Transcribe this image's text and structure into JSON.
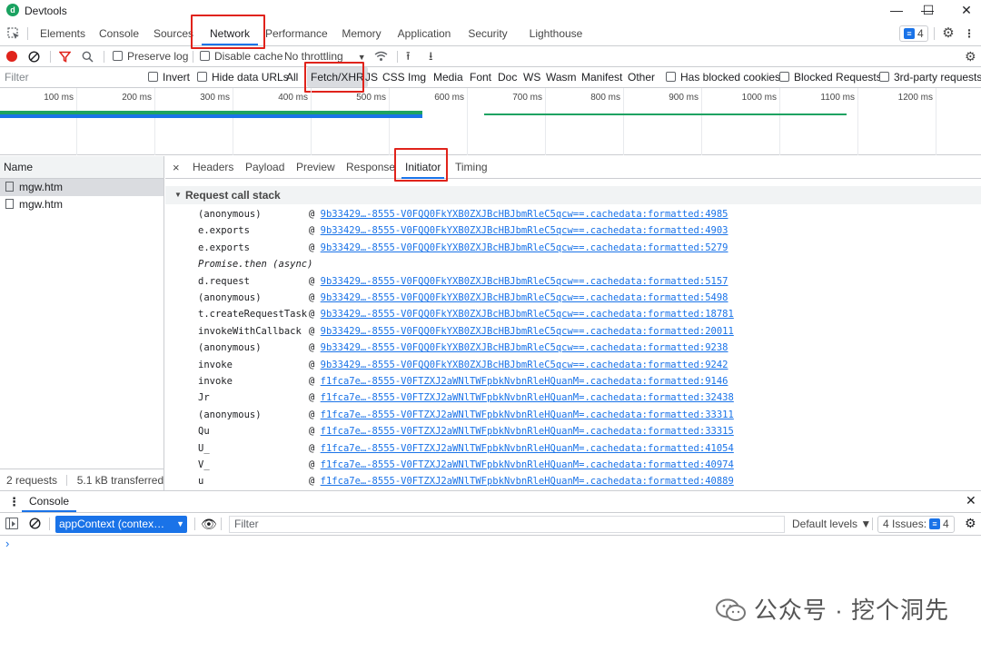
{
  "window": {
    "title": "Devtools",
    "minimize": "—",
    "maximize": "☐",
    "close": "✕"
  },
  "panel_tabs": [
    "Elements",
    "Console",
    "Sources",
    "Network",
    "Performance",
    "Memory",
    "Application",
    "Security",
    "Lighthouse"
  ],
  "active_panel": "Network",
  "issues_count": "4",
  "toolbar": {
    "preserve_log": "Preserve log",
    "disable_cache": "Disable cache",
    "throttling": "No throttling"
  },
  "filterbar": {
    "placeholder": "Filter",
    "invert": "Invert",
    "hide_data_urls": "Hide data URLs",
    "types": [
      "All",
      "Fetch/XHR",
      "JS",
      "CSS",
      "Img",
      "Media",
      "Font",
      "Doc",
      "WS",
      "Wasm",
      "Manifest",
      "Other"
    ],
    "has_blocked_cookies": "Has blocked cookies",
    "blocked_requests": "Blocked Requests",
    "third_party": "3rd-party requests"
  },
  "timeline": {
    "ticks": [
      "100 ms",
      "200 ms",
      "300 ms",
      "400 ms",
      "500 ms",
      "600 ms",
      "700 ms",
      "800 ms",
      "900 ms",
      "1000 ms",
      "1100 ms",
      "1200 ms"
    ]
  },
  "requests": {
    "header": "Name",
    "rows": [
      "mgw.htm",
      "mgw.htm"
    ],
    "summary_requests": "2 requests",
    "summary_transferred": "5.1 kB transferred"
  },
  "detail_tabs": [
    "Headers",
    "Payload",
    "Preview",
    "Response",
    "Initiator",
    "Timing"
  ],
  "active_detail_tab": "Initiator",
  "call_stack": {
    "title": "Request call stack",
    "frames": [
      {
        "fn": "(anonymous)",
        "loc": "9b33429…-8555-V0FQQ0FkYXB0ZXJBcHBJbmRleC5qcw==.cachedata:formatted:4985"
      },
      {
        "fn": "e.exports",
        "loc": "9b33429…-8555-V0FQQ0FkYXB0ZXJBcHBJbmRleC5qcw==.cachedata:formatted:4903"
      },
      {
        "fn": "e.exports",
        "loc": "9b33429…-8555-V0FQQ0FkYXB0ZXJBcHBJbmRleC5qcw==.cachedata:formatted:5279"
      },
      {
        "fn": "Promise.then (async)",
        "loc": "",
        "async": true
      },
      {
        "fn": "d.request",
        "loc": "9b33429…-8555-V0FQQ0FkYXB0ZXJBcHBJbmRleC5qcw==.cachedata:formatted:5157"
      },
      {
        "fn": "(anonymous)",
        "loc": "9b33429…-8555-V0FQQ0FkYXB0ZXJBcHBJbmRleC5qcw==.cachedata:formatted:5498"
      },
      {
        "fn": "t.createRequestTask",
        "loc": "9b33429…-8555-V0FQQ0FkYXB0ZXJBcHBJbmRleC5qcw==.cachedata:formatted:18781"
      },
      {
        "fn": "invokeWithCallback",
        "loc": "9b33429…-8555-V0FQQ0FkYXB0ZXJBcHBJbmRleC5qcw==.cachedata:formatted:20011"
      },
      {
        "fn": "(anonymous)",
        "loc": "9b33429…-8555-V0FQQ0FkYXB0ZXJBcHBJbmRleC5qcw==.cachedata:formatted:9238"
      },
      {
        "fn": "invoke",
        "loc": "9b33429…-8555-V0FQQ0FkYXB0ZXJBcHBJbmRleC5qcw==.cachedata:formatted:9242"
      },
      {
        "fn": "invoke",
        "loc": "f1fca7e…-8555-V0FTZXJ2aWNlTWFpbkNvbnRleHQuanM=.cachedata:formatted:9146"
      },
      {
        "fn": "Jr",
        "loc": "f1fca7e…-8555-V0FTZXJ2aWNlTWFpbkNvbnRleHQuanM=.cachedata:formatted:32438"
      },
      {
        "fn": "(anonymous)",
        "loc": "f1fca7e…-8555-V0FTZXJ2aWNlTWFpbkNvbnRleHQuanM=.cachedata:formatted:33311"
      },
      {
        "fn": "Qu",
        "loc": "f1fca7e…-8555-V0FTZXJ2aWNlTWFpbkNvbnRleHQuanM=.cachedata:formatted:33315"
      },
      {
        "fn": "U_",
        "loc": "f1fca7e…-8555-V0FTZXJ2aWNlTWFpbkNvbnRleHQuanM=.cachedata:formatted:41054"
      },
      {
        "fn": "V_",
        "loc": "f1fca7e…-8555-V0FTZXJ2aWNlTWFpbkNvbnRleHQuanM=.cachedata:formatted:40974"
      },
      {
        "fn": "u",
        "loc": "f1fca7e…-8555-V0FTZXJ2aWNlTWFpbkNvbnRleHQuanM=.cachedata:formatted:40889"
      }
    ]
  },
  "drawer": {
    "tab": "Console",
    "context": "appContext (contex…",
    "filter_placeholder": "Filter",
    "levels": "Default levels ▼",
    "issues": "4 Issues:",
    "issues_badge": "4",
    "prompt": "›"
  },
  "watermark": "公众号 · 挖个洞先",
  "colors": {
    "accent": "#1a73e8",
    "highlight": "#e0231b",
    "bar_green": "#1ea362",
    "bar_blue": "#1a73e8"
  }
}
